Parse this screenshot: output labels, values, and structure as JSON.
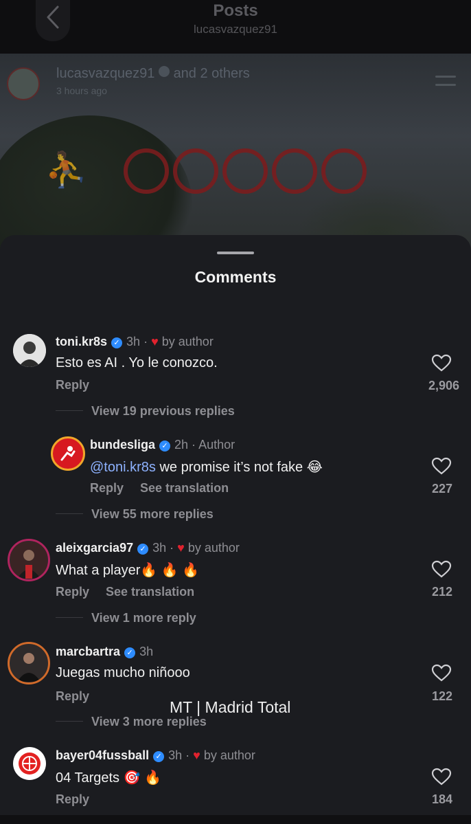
{
  "header": {
    "title": "Posts",
    "subtitle": "lucasvazquez91"
  },
  "post": {
    "user": "lucasvazquez91",
    "collab": "and 2 others",
    "time": "3 hours ago"
  },
  "sheet": {
    "title": "Comments"
  },
  "comments": [
    {
      "user": "toni.kr8s",
      "time": "3h",
      "badge": "by author",
      "text": "Esto es AI . Yo le conozco.",
      "reply": "Reply",
      "likes": "2,906",
      "view_more": "View 19 previous replies"
    },
    {
      "user": "bundesliga",
      "time": "2h",
      "badge": "Author",
      "mention": "@toni.kr8s",
      "text": " we promise it’s not fake 😂",
      "reply": "Reply",
      "translate": "See translation",
      "likes": "227",
      "view_more": "View 55 more replies"
    },
    {
      "user": "aleixgarcia97",
      "time": "3h",
      "badge": "by author",
      "text": "What a player🔥 🔥 🔥",
      "reply": "Reply",
      "translate": "See translation",
      "likes": "212",
      "view_more": "View 1 more reply"
    },
    {
      "user": "marcbartra",
      "time": "3h",
      "text": "Juegas mucho niñooo",
      "reply": "Reply",
      "likes": "122",
      "view_more": "View 3 more replies"
    },
    {
      "user": "bayer04fussball",
      "time": "3h",
      "badge": "by author",
      "text": "04 Targets 🎯 🔥",
      "reply": "Reply",
      "likes": "184"
    }
  ],
  "watermark": "MT | Madrid Total",
  "colors": {
    "sheet_bg": "#1b1c20",
    "verified": "#2e8cff",
    "heart": "#e0222e",
    "mention": "#8eb2ff"
  }
}
